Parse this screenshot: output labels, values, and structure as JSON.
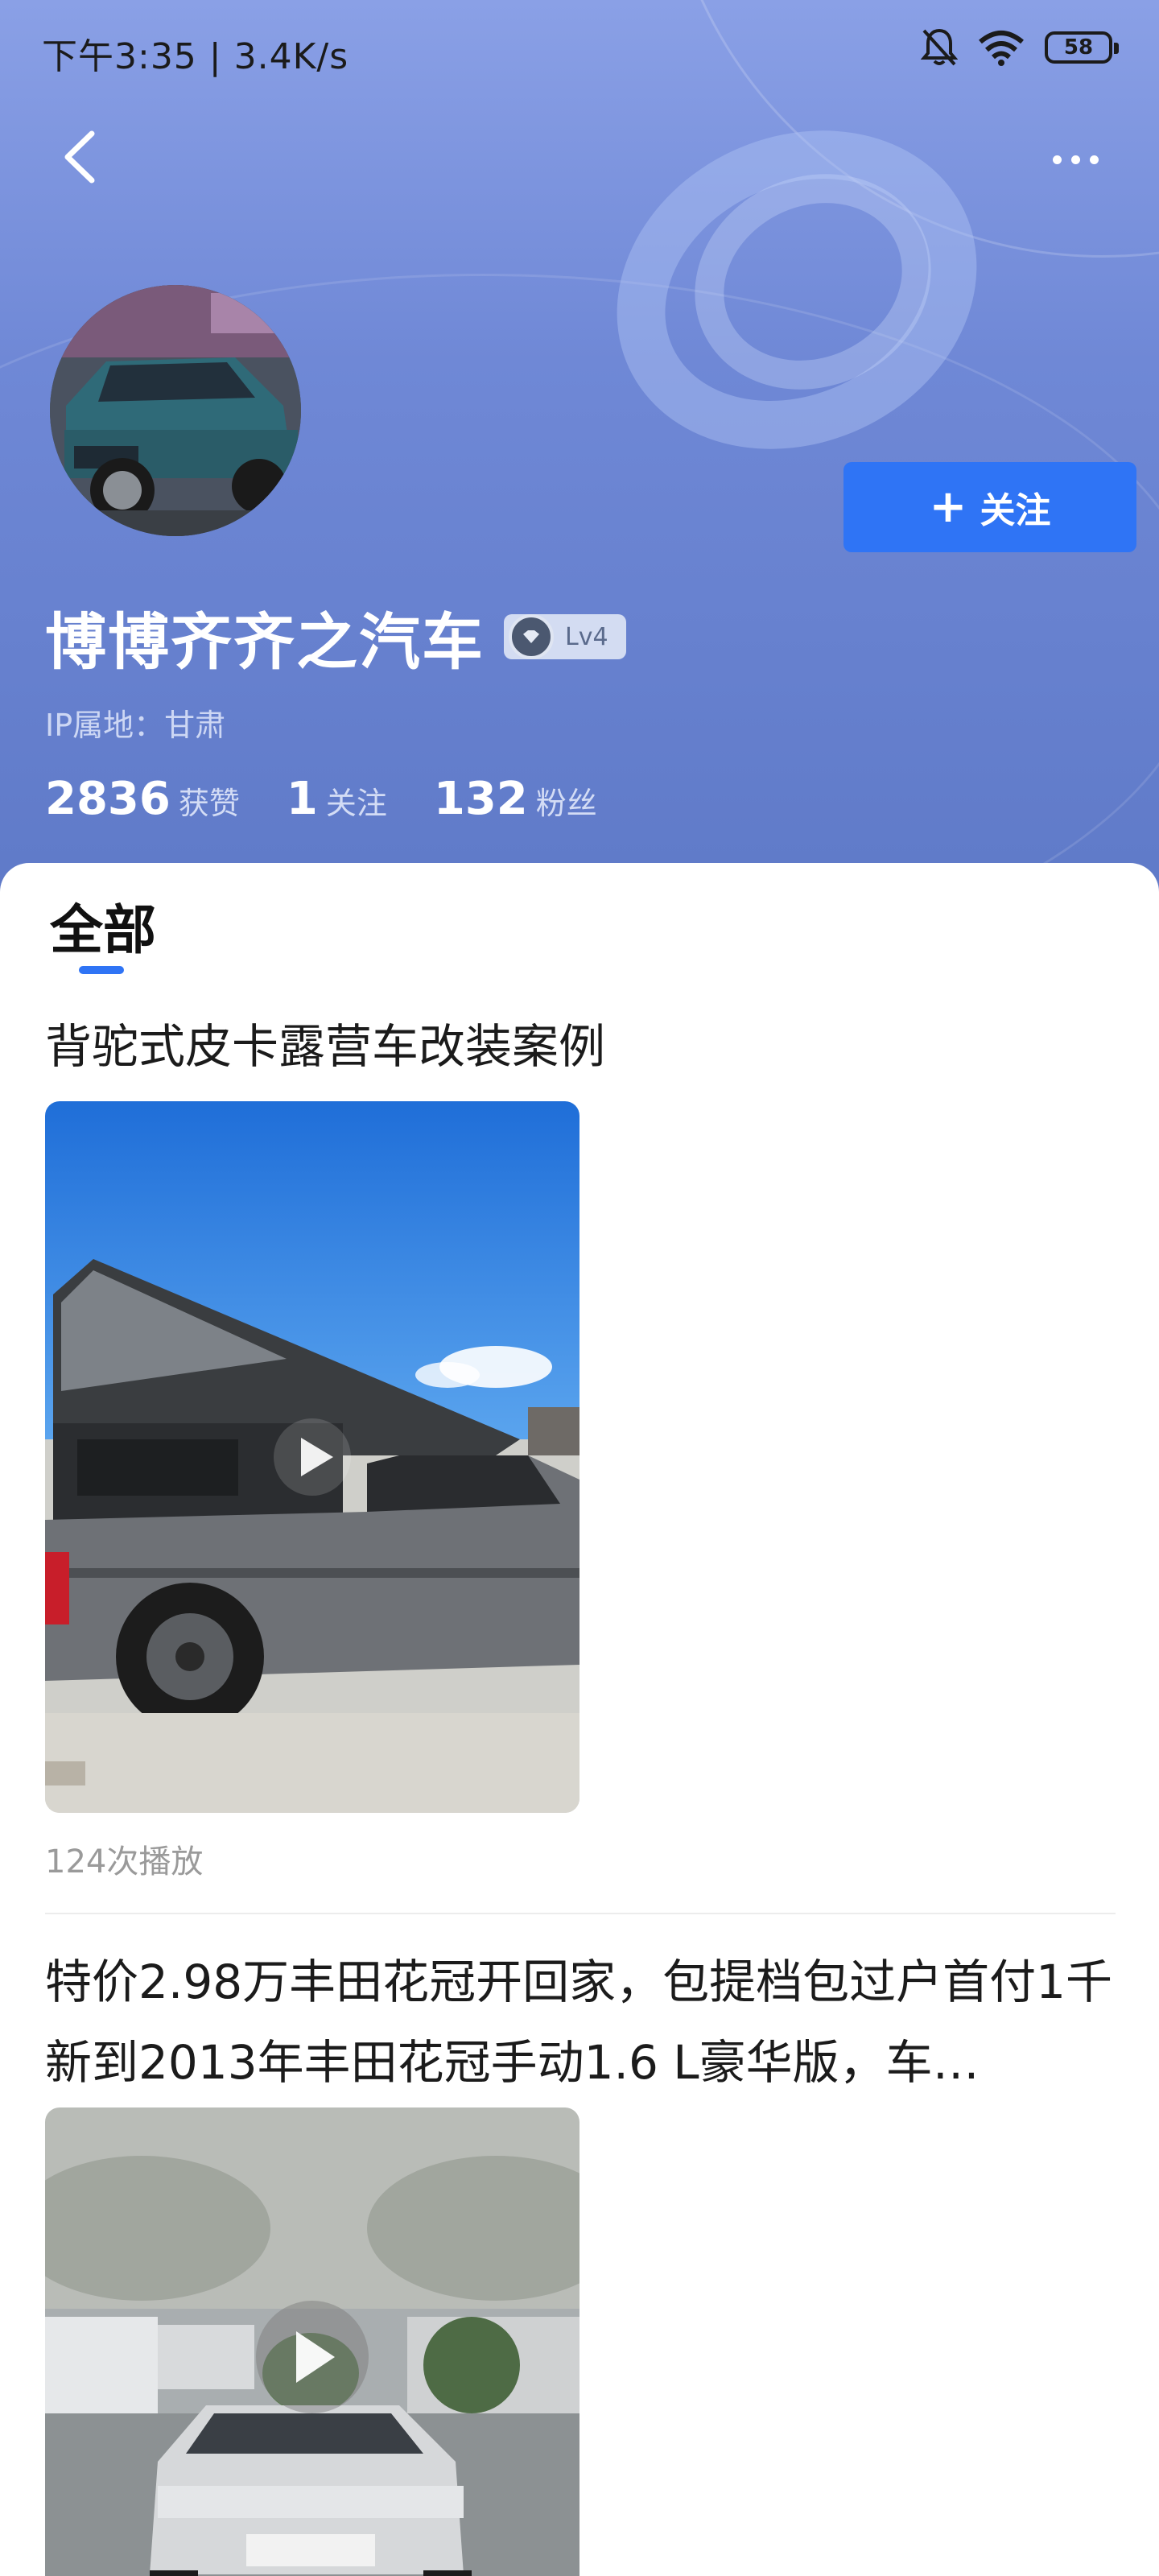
{
  "status_bar": {
    "time": "下午3:35 | 3.4K/s",
    "battery": "58"
  },
  "profile": {
    "name": "博博齐齐之汽车",
    "level": "Lv4",
    "ip_location": "IP属地：甘肃",
    "follow_button": "关注",
    "follow_plus": "+",
    "stats": [
      {
        "value": "2836",
        "label": "获赞"
      },
      {
        "value": "1",
        "label": "关注"
      },
      {
        "value": "132",
        "label": "粉丝"
      }
    ]
  },
  "tabs": {
    "all": "全部"
  },
  "posts": [
    {
      "title": "背驼式皮卡露营车改装案例",
      "plays": "124次播放"
    },
    {
      "title": "特价2.98万丰田花冠开回家，包提档包过户首付1千 新到2013年丰田花冠手动1.6 L豪华版，车…"
    }
  ],
  "colors": {
    "accent": "#2f74f5",
    "header_gradient_top": "#8aa0e6",
    "header_gradient_bottom": "#5f7ac8"
  },
  "icons": {
    "back": "chevron-left-icon",
    "more": "more-dots-icon",
    "mute": "bell-off-icon",
    "wifi": "wifi-icon",
    "battery": "battery-icon",
    "level": "diamond-icon",
    "play": "play-icon"
  }
}
